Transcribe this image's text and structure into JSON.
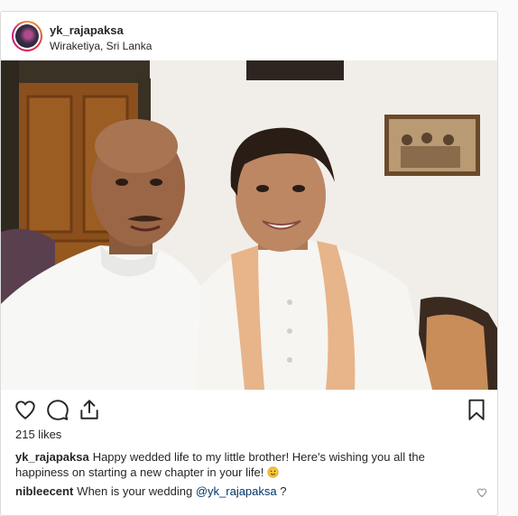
{
  "post": {
    "username": "yk_rajapaksa",
    "location": "Wiraketiya, Sri Lanka",
    "likes": "215 likes",
    "caption": {
      "username": "yk_rajapaksa",
      "text": "Happy wedded life to my little brother! Here's wishing you all the happiness on starting a new chapter in your life!",
      "emoji": "smiling-face-emoji"
    },
    "comments": [
      {
        "username": "nibleecent",
        "text_before": "When is your wedding",
        "mention": "@yk_rajapaksa",
        "text_after": "?"
      }
    ]
  },
  "icons": {
    "like": "heart-icon",
    "comment": "speech-bubble-icon",
    "share": "share-icon",
    "save": "bookmark-icon",
    "comment_like": "heart-icon"
  },
  "colors": {
    "story_ring": "#dc2743",
    "link": "#003569",
    "text": "#262626"
  }
}
